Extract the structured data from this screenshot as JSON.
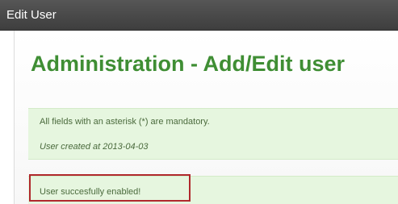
{
  "window": {
    "title": "Edit User"
  },
  "page": {
    "heading": "Administration - Add/Edit user"
  },
  "info": {
    "mandatory_note": "All fields with an asterisk (*) are mandatory.",
    "created_note": "User created at 2013-04-03"
  },
  "notification": {
    "message": "User succesfully enabled!",
    "highlight_color": "#b0282c"
  },
  "colors": {
    "titlebar": "#4a4a4a",
    "heading": "#3f8e34",
    "message_background": "#e6f6df"
  }
}
